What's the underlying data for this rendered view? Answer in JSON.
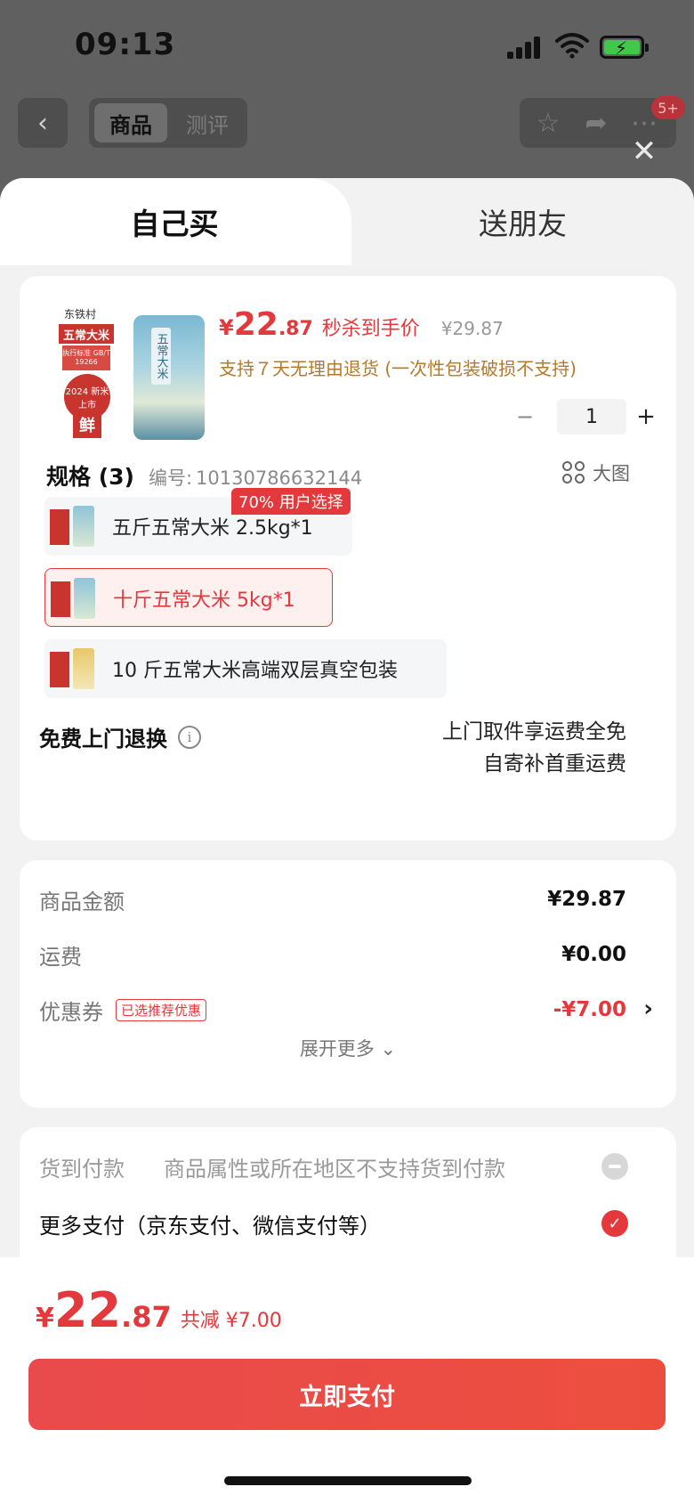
{
  "status_bar": {
    "time": "09:13"
  },
  "top_nav": {
    "back": "‹",
    "tabs": [
      "商品",
      "测评"
    ],
    "cart_badge": "5+",
    "close": "✕"
  },
  "sheet_tabs": {
    "self": "自己买",
    "friend": "送朋友"
  },
  "product": {
    "image_text": {
      "brand": "东铁村",
      "title": "五常大米",
      "standard": "执行标准 GB/T 19266",
      "medal": "2024 新米上市",
      "fresh": "鲜",
      "bag_label": "五常大米"
    },
    "price_yen": "¥",
    "price_int": "22",
    "price_dec": ".87",
    "price_tag": "秒杀到手价",
    "orig_price": "¥29.87",
    "return_policy": "支持７天无理由退货 (一次性包装破损不支持)",
    "qty_minus": "−",
    "quantity": "1",
    "qty_plus": "+"
  },
  "spec": {
    "title": "规格 (3)",
    "code_label": "编号:",
    "code": "10130786632144",
    "big_pic": "大图",
    "hot_tag": "70% 用户选择",
    "options": [
      {
        "label": "五斤五常大米 2.5kg*1",
        "selected": false
      },
      {
        "label": "十斤五常大米 5kg*1",
        "selected": true
      },
      {
        "label": "10 斤五常大米高端双层真空包装",
        "selected": false
      }
    ]
  },
  "free_return": {
    "label": "免费上门退换",
    "info": "i",
    "line1": "上门取件享运费全免",
    "line2": "自寄补首重运费"
  },
  "summary": {
    "goods_label": "商品金额",
    "goods_value": "¥29.87",
    "shipping_label": "运费",
    "shipping_value": "¥0.00",
    "coupon_label": "优惠券",
    "coupon_tag": "已选推荐优惠",
    "coupon_value": "-¥7.00",
    "chevron": "›",
    "expand": "展开更多 ⌄"
  },
  "payment": {
    "cod_label": "货到付款",
    "cod_note": "商品属性或所在地区不支持货到付款",
    "more_label": "更多支付（京东支付、微信支付等）",
    "check": "✓"
  },
  "bottom": {
    "yen": "¥",
    "total_int": "22",
    "total_dec": ".87",
    "save_text": "共减 ¥7.00",
    "pay_button": "立即支付"
  },
  "colors": {
    "accent": "#e4393c",
    "policy": "#b47a2a"
  },
  "icons": [
    "back-icon",
    "star-icon",
    "share-icon",
    "more-icon",
    "close-icon",
    "grid-icon",
    "info-icon",
    "chevron-right-icon",
    "chevron-down-icon",
    "minus-circle-icon",
    "check-circle-icon"
  ]
}
